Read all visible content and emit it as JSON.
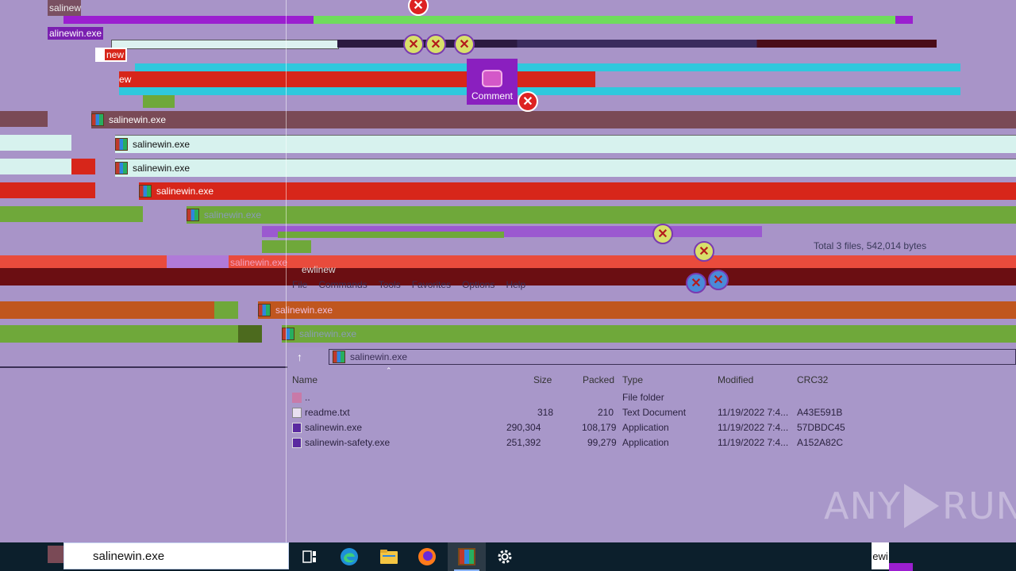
{
  "window": {
    "app_name_fragment_top": "salinew",
    "exe_label_small": "alinewin.exe",
    "frag_ew": "ew",
    "frag_new": "new",
    "frag_wi_new": "ewlinew"
  },
  "cascade_titles": [
    "salinewin.exe",
    "salinewin.exe",
    "salinewin.exe",
    "salinewin.exe",
    "salinewin.exe",
    "salinewin.exe",
    "salinewin.exe",
    "salinewin.exe"
  ],
  "comment_button": {
    "label": "Comment"
  },
  "status": {
    "total": "Total 3 files, 542,014 bytes"
  },
  "menu": {
    "items": [
      "File",
      "Commands",
      "Tools",
      "Favorites",
      "Options",
      "Help"
    ]
  },
  "path_bar": {
    "archive": "salinewin.exe"
  },
  "file_list": {
    "columns": [
      "Name",
      "Size",
      "Packed",
      "Type",
      "Modified",
      "CRC32"
    ],
    "rows": [
      {
        "name": "..",
        "size": "",
        "packed": "",
        "type": "File folder",
        "modified": "",
        "crc": ""
      },
      {
        "name": "readme.txt",
        "size": "318",
        "packed": "210",
        "type": "Text Document",
        "modified": "11/19/2022 7:4...",
        "crc": "A43E591B"
      },
      {
        "name": "salinewin.exe",
        "size": "290,304",
        "packed": "108,179",
        "type": "Application",
        "modified": "11/19/2022 7:4...",
        "crc": "57DBDC45"
      },
      {
        "name": "salinewin-safety.exe",
        "size": "251,392",
        "packed": "99,279",
        "type": "Application",
        "modified": "11/19/2022 7:4...",
        "crc": "A152A82C"
      }
    ]
  },
  "taskbar": {
    "search_value": "salinewin.exe",
    "right_fragment": "ewi",
    "icons": [
      "task-view-icon",
      "edge-icon",
      "file-explorer-icon",
      "firefox-icon",
      "winrar-icon",
      "settings-icon"
    ]
  },
  "watermark": {
    "text_left": "ANY",
    "text_right": "RUN"
  }
}
